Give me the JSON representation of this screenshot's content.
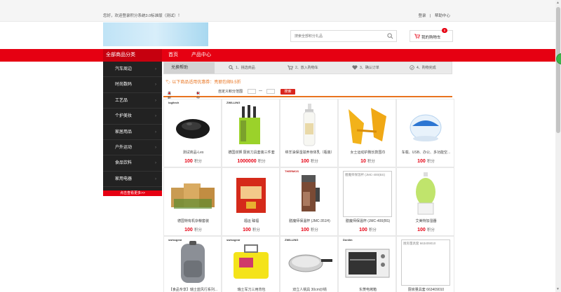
{
  "topbar": {
    "greeting": "您好，欢迎登录积分系统3.0标准版（测试）！",
    "login": "登录",
    "divider": "|",
    "help": "帮助中心"
  },
  "search": {
    "placeholder": "搜索全部积分礼品"
  },
  "cart": {
    "label": "我的购物车",
    "count": "0"
  },
  "nav": {
    "all_categories": "全部商品分类",
    "home": "首页",
    "products": "产品中心"
  },
  "categories": [
    "汽车周边",
    "时尚数码",
    "工艺品",
    "个护美妆",
    "家居用品",
    "户外运动",
    "食品饮料",
    "家用电器"
  ],
  "categories_more": "点击查看更多>>",
  "steps": {
    "header": "兑换帮助",
    "items": [
      "1、挑选商品",
      "2、放入购物车",
      "3、确认订单",
      "4、购物完成"
    ]
  },
  "promo": "以下商品适用优惠券：亮丽包邮9.5折",
  "filter": {
    "newest": "最新上架",
    "points": "积分值",
    "range_label": "自定义积分范围",
    "dash": "—",
    "search_button": "搜索"
  },
  "price_unit": "积分",
  "products": [
    {
      "name": "测试商品-Les",
      "price": "100",
      "brand": "logitech",
      "image": "mouse"
    },
    {
      "name": "德国双狮 厨房刀具套装三件套",
      "price": "1000000",
      "brand": "ZWILLING",
      "image": "knife-block"
    },
    {
      "name": "绵羊油保湿滋养身体乳（瓶装）",
      "price": "100",
      "brand": "",
      "image": "lotion-bottle"
    },
    {
      "name": "女士运动护腕长款围巾",
      "price": "10",
      "brand": "",
      "image": "yellow-gloves"
    },
    {
      "name": "车载、USB、办公、多功能空...",
      "price": "100",
      "brand": "",
      "image": "air-purifier"
    },
    {
      "name": "德国特有机杂粮套装",
      "price": "100",
      "brand": "",
      "image": "grain-boxes"
    },
    {
      "name": "福运 臻福",
      "price": "100",
      "brand": "",
      "image": "gift-box"
    },
    {
      "name": "膳魔师保温杯 (JMC-351H)",
      "price": "100",
      "brand": "THERMOS",
      "image": "thermos-cup"
    },
    {
      "name": "膳魔师保温杯 (JMC-400(BS)",
      "price": "100",
      "brand": "",
      "image": "broken",
      "broken_alt": "膳魔师保温杯 (JMC-400(BS)"
    },
    {
      "name": "艾美特加湿器",
      "price": "100",
      "brand": "",
      "image": "humidifier"
    },
    {
      "name": "【食品专享】瑞士蓝风行系列...",
      "price": "100",
      "brand": "swissgear",
      "image": "backpack"
    },
    {
      "name": "瑞士军刀三用背包",
      "price": "100",
      "brand": "swissgear",
      "image": "yellow-bag"
    },
    {
      "name": "双立人锅具 30cm炒锅",
      "price": "100",
      "brand": "ZWILLING",
      "image": "wok"
    },
    {
      "name": "东菱电烤箱",
      "price": "100",
      "brand": "Donlim",
      "image": "oven"
    },
    {
      "name": "厨房量具套 663409010",
      "price": "100",
      "brand": "",
      "image": "broken",
      "broken_alt": "厨房量具套 663409010"
    }
  ]
}
